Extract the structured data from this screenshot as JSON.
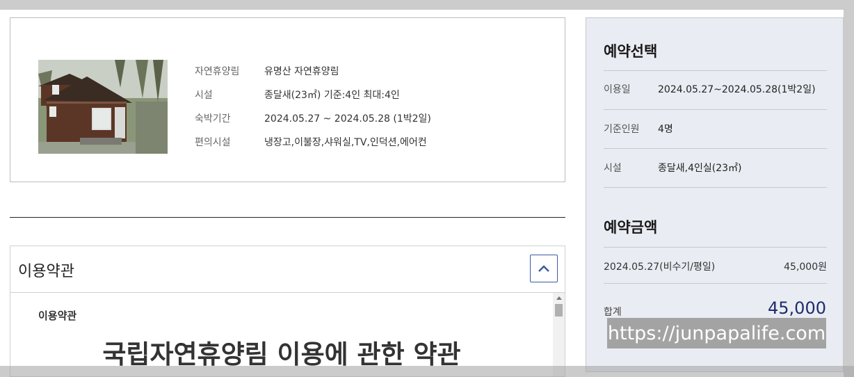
{
  "facility": {
    "rows": [
      {
        "label": "자연휴양림",
        "value": "유명산 자연휴양림"
      },
      {
        "label": "시설",
        "value": "종달새(23㎡) 기준:4인 최대:4인"
      },
      {
        "label": "숙박기간",
        "value": "2024.05.27 ~ 2024.05.28 (1박2일)"
      },
      {
        "label": "편의시설",
        "value": "냉장고,이불장,샤워실,TV,인덕션,에어컨"
      }
    ]
  },
  "terms": {
    "title": "이용약관",
    "sub_title": "이용약관",
    "heading": "국립자연휴양림 이용에 관한 약관",
    "toggle_icon": "chevron-up-icon"
  },
  "reservation": {
    "title": "예약선택",
    "rows": [
      {
        "label": "이용일",
        "value": "2024.05.27~2024.05.28(1박2일)"
      },
      {
        "label": "기준인원",
        "value": "4명"
      },
      {
        "label": "시설",
        "value": "종달새,4인실(23㎡)"
      }
    ]
  },
  "price": {
    "title": "예약금액",
    "line": {
      "label": "2024.05.27(비수기/평일)",
      "amount": "45,000원"
    },
    "total_label": "합계",
    "total_value": "45,000"
  },
  "watermark": "https://junpapalife.com",
  "colors": {
    "accent": "#3a5aa6",
    "total": "#1e2d6b",
    "panel_bg": "#e9ecf2"
  }
}
